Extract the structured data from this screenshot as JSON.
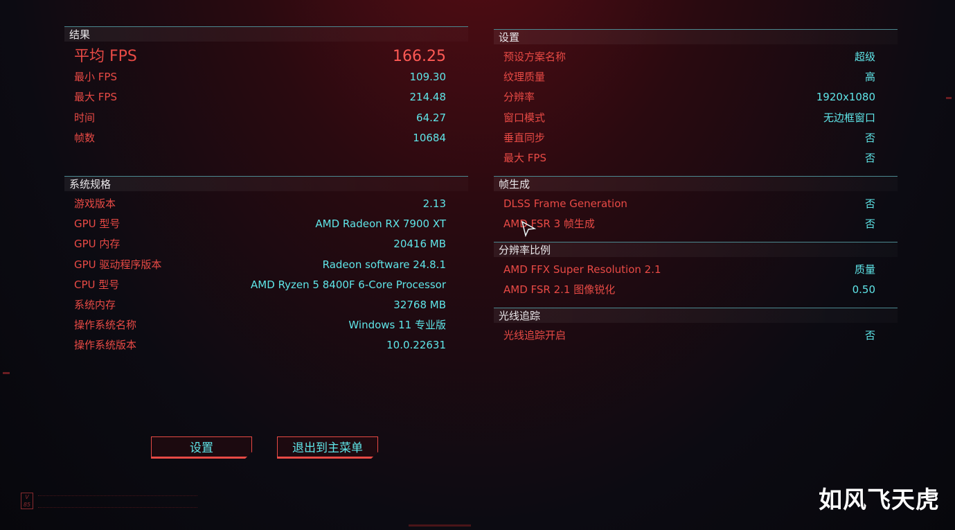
{
  "results": {
    "header": "结果",
    "avg_fps": {
      "label": "平均 FPS",
      "value": "166.25"
    },
    "rows": [
      {
        "label": "最小 FPS",
        "value": "109.30"
      },
      {
        "label": "最大 FPS",
        "value": "214.48"
      },
      {
        "label": "时间",
        "value": "64.27"
      },
      {
        "label": "帧数",
        "value": "10684"
      }
    ]
  },
  "system": {
    "header": "系统规格",
    "rows": [
      {
        "label": "游戏版本",
        "value": "2.13"
      },
      {
        "label": "GPU 型号",
        "value": "AMD Radeon RX 7900 XT"
      },
      {
        "label": "GPU 内存",
        "value": "20416 MB"
      },
      {
        "label": "GPU 驱动程序版本",
        "value": "Radeon software 24.8.1"
      },
      {
        "label": "CPU 型号",
        "value": "AMD Ryzen 5 8400F 6-Core Processor"
      },
      {
        "label": "系统内存",
        "value": "32768 MB"
      },
      {
        "label": "操作系统名称",
        "value": "Windows 11 专业版"
      },
      {
        "label": "操作系统版本",
        "value": "10.0.22631"
      }
    ]
  },
  "settings": {
    "header": "设置",
    "rows": [
      {
        "label": "预设方案名称",
        "value": "超级"
      },
      {
        "label": "纹理质量",
        "value": "高"
      },
      {
        "label": "分辨率",
        "value": "1920x1080"
      },
      {
        "label": "窗口模式",
        "value": "无边框窗口"
      },
      {
        "label": "垂直同步",
        "value": "否"
      },
      {
        "label": "最大 FPS",
        "value": "否"
      }
    ]
  },
  "frame_gen": {
    "header": "帧生成",
    "rows": [
      {
        "label": "DLSS Frame Generation",
        "value": "否"
      },
      {
        "label": "AMD FSR 3 帧生成",
        "value": "否"
      }
    ]
  },
  "res_scaling": {
    "header": "分辨率比例",
    "rows": [
      {
        "label": "AMD FFX Super Resolution 2.1",
        "value": "质量"
      },
      {
        "label": "AMD FSR 2.1 图像锐化",
        "value": "0.50"
      }
    ]
  },
  "ray_tracing": {
    "header": "光线追踪",
    "rows": [
      {
        "label": "光线追踪开启",
        "value": "否"
      }
    ]
  },
  "buttons": {
    "settings": "设置",
    "exit": "退出到主菜单"
  },
  "watermark": "如风飞天虎",
  "logo": "V 85",
  "colors": {
    "label": "#e84a45",
    "value": "#5fe6e9",
    "header_text": "#e9e7ea",
    "divider": "#4c8a91"
  }
}
